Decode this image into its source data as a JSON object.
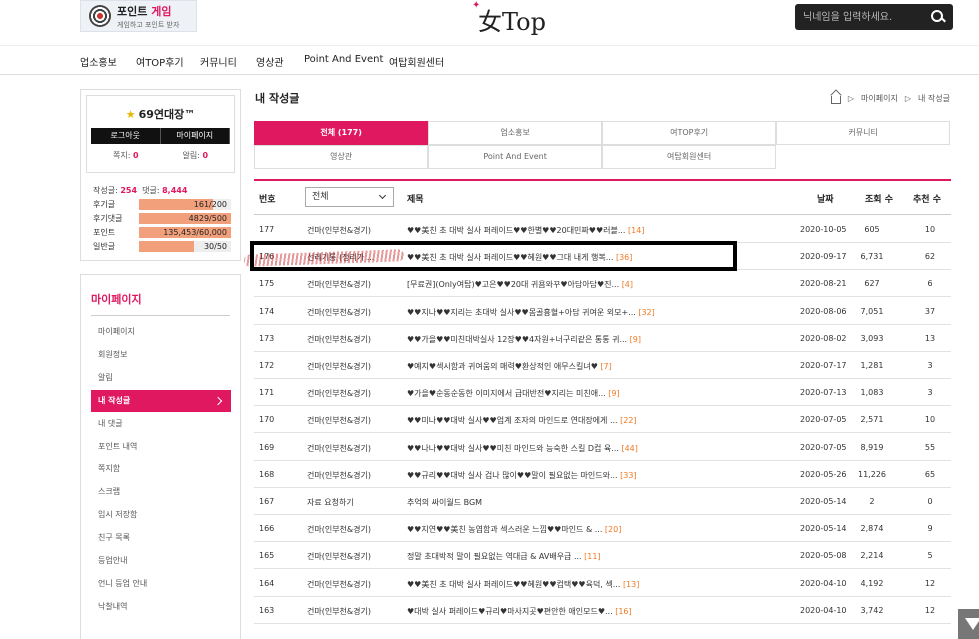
{
  "header": {
    "promo_title_a": "포인트 ",
    "promo_title_b": "게임",
    "promo_sub": "게임하고 포인트 받자",
    "logo": "女Top",
    "search_placeholder": "닉네임을 입력하세요."
  },
  "nav": [
    "업소홍보",
    "여TOP후기",
    "커뮤니티",
    "영상관",
    "Point And Event",
    "여탑회원센터"
  ],
  "profile": {
    "nickname": "69연대장™",
    "logout": "로그아웃",
    "mypage": "마이페이지",
    "note_label": "쪽지:",
    "note_count": "0",
    "alarm_label": "알림:",
    "alarm_count": "0",
    "posts_label": "작성글:",
    "posts_count": "254",
    "comments_label": "댓글:",
    "comments_count": "8,444",
    "bars": [
      {
        "label": "후기글",
        "text": "161/200",
        "fraction": 0.805
      },
      {
        "label": "후기댓글",
        "text": "4829/500",
        "fraction": 1.0
      },
      {
        "label": "포인트",
        "text": "135,453/60,000",
        "fraction": 1.0
      },
      {
        "label": "일반글",
        "text": "30/50",
        "fraction": 0.6
      }
    ]
  },
  "sidemenu": {
    "title": "마이페이지",
    "items": [
      "마이페이지",
      "회원정보",
      "알림",
      "내 작성글",
      "내 댓글",
      "포인트 내역",
      "쪽지함",
      "스크랩",
      "임시 저장함",
      "친구 목록",
      "등업안내",
      "언니 등업 안내",
      "낙찰내역"
    ],
    "active": "내 작성글"
  },
  "page": {
    "title": "내 작성글",
    "breadcrumb": [
      "마이페이지",
      "내 작성글"
    ]
  },
  "tabs": [
    "전체 (177)",
    "업소홍보",
    "여TOP후기",
    "커뮤니티",
    "영상관",
    "Point And Event",
    "여탑회원센터"
  ],
  "table": {
    "headers": {
      "num": "번호",
      "title": "제목",
      "date": "날짜",
      "views": "조회 수",
      "rec": "추천 수"
    },
    "filter": "전체",
    "rows": [
      {
        "num": "177",
        "author": "건마(인부천&경기)",
        "title": "♥♥美친 초 대박 실사 퍼레이드♥♥한별♥♥20대민짜♥♥러블... ",
        "comments": "[14]",
        "date": "2020-10-05",
        "views": "605",
        "rec": "10"
      },
      {
        "num": "176",
        "author": "선레기통 (정리가 ...",
        "title": "♥♥美친 초 대박 실사 퍼레이드♥♥혜원♥♥그대 내게 행복... ",
        "comments": "[36]",
        "date": "2020-09-17",
        "views": "6,731",
        "rec": "62"
      },
      {
        "num": "175",
        "author": "건마(인부천&경기)",
        "title": "[무료권](Only여탑)♥고은♥♥20대 귀욤와꾸♥아담아담♥진... ",
        "comments": "[4]",
        "date": "2020-08-21",
        "views": "627",
        "rec": "6"
      },
      {
        "num": "174",
        "author": "건마(인부천&경기)",
        "title": "♥♥지나♥♥지리는 초대박 실사♥♥몸골흉혈+아담 귀여운 외모+... ",
        "comments": "[32]",
        "date": "2020-08-06",
        "views": "7,051",
        "rec": "37"
      },
      {
        "num": "173",
        "author": "건마(인부천&경기)",
        "title": "♥♥가을♥♥미친대박실사 12장♥♥4자원+너구리같은 통통 귀... ",
        "comments": "[9]",
        "date": "2020-08-02",
        "views": "3,093",
        "rec": "13"
      },
      {
        "num": "172",
        "author": "건마(인부천&경기)",
        "title": "♥예지♥섹시함과 귀여움의 매력♥환상적인 애무스킬녀♥ ",
        "comments": "[7]",
        "date": "2020-07-17",
        "views": "1,281",
        "rec": "3"
      },
      {
        "num": "171",
        "author": "건마(인부천&경기)",
        "title": "♥가을♥순동순동한 이미지에서 급대반전♥지리는 미친애... ",
        "comments": "[9]",
        "date": "2020-07-13",
        "views": "1,083",
        "rec": "3"
      },
      {
        "num": "170",
        "author": "건마(인부천&경기)",
        "title": "♥♥미나♥♥대박 실사♥♥업계 조자의 마인드로 연대장에게 ... ",
        "comments": "[22]",
        "date": "2020-07-05",
        "views": "2,571",
        "rec": "10"
      },
      {
        "num": "169",
        "author": "건마(인부천&경기)",
        "title": "♥♥나나♥♥대박 실사♥♥미친 마인드와 능숙한 스킬 D컵 육... ",
        "comments": "[44]",
        "date": "2020-07-05",
        "views": "8,919",
        "rec": "55"
      },
      {
        "num": "168",
        "author": "건마(인부천&경기)",
        "title": "♥♥규리♥♥대박 실사 겁나 많이♥♥말이 필요없는 마인드와... ",
        "comments": "[33]",
        "date": "2020-05-26",
        "views": "11,226",
        "rec": "65"
      },
      {
        "num": "167",
        "author": "자료 요청하기",
        "title": "추억의 싸이월드 BGM",
        "comments": "",
        "date": "2020-05-14",
        "views": "2",
        "rec": "0"
      },
      {
        "num": "166",
        "author": "건마(인부천&경기)",
        "title": "♥♥지연♥♥美친 농염함과 섹스러운 느낌♥♥마인드 & ... ",
        "comments": "[20]",
        "date": "2020-05-14",
        "views": "2,874",
        "rec": "9"
      },
      {
        "num": "165",
        "author": "건마(인부천&경기)",
        "title": "정말 초대박적 말이 필요없는 역대급 & AV배우급 ... ",
        "comments": "[11]",
        "date": "2020-05-08",
        "views": "2,214",
        "rec": "5"
      },
      {
        "num": "164",
        "author": "건마(인부천&경기)",
        "title": "♥♥美친 초 대박 실사 퍼레이드♥♥혜원♥♥컴택♥♥육덕, 섹... ",
        "comments": "[13]",
        "date": "2020-04-10",
        "views": "4,192",
        "rec": "12"
      },
      {
        "num": "163",
        "author": "건마(인부천&경기)",
        "title": "♥대박 실사 퍼레이드♥규리♥마사지곳♥편안한 애인모드♥... ",
        "comments": "[16]",
        "date": "2020-04-10",
        "views": "3,742",
        "rec": "12"
      }
    ]
  }
}
